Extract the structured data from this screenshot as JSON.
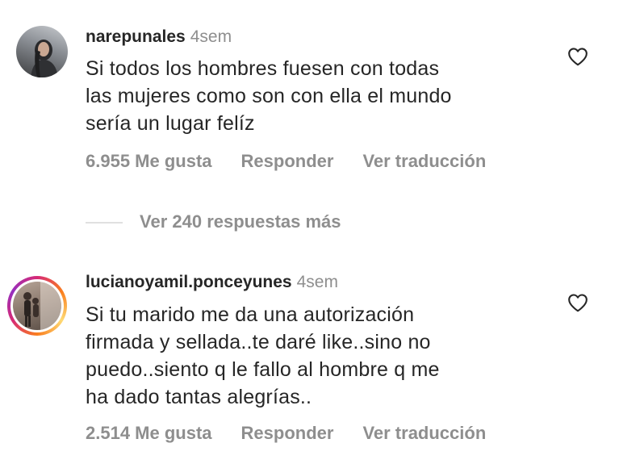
{
  "comments": [
    {
      "username": "narepunales",
      "time": "4sem",
      "text_lines": [
        "Si todos los hombres fuesen con todas",
        "las mujeres como son con ella el mundo",
        "sería un lugar felíz"
      ],
      "likes": "6.955 Me gusta",
      "reply_label": "Responder",
      "translate_label": "Ver traducción",
      "avatar_icon": "user-avatar",
      "like_icon": "heart-outline-icon"
    },
    {
      "username": "lucianoyamil.ponceyunes",
      "time": "4sem",
      "text_lines": [
        "Si tu marido me da una autorización",
        "firmada y sellada..te daré like..sino no",
        "puedo..siento q le fallo al hombre q me",
        "ha dado tantas alegrías.."
      ],
      "likes": "2.514 Me gusta",
      "reply_label": "Responder",
      "translate_label": "Ver traducción",
      "avatar_icon": "user-avatar-story-ring",
      "like_icon": "heart-outline-icon"
    }
  ],
  "view_replies_label": "Ver 240 respuestas más",
  "colors": {
    "text_primary": "#262626",
    "text_secondary": "#8e8e8e",
    "background": "#ffffff",
    "divider": "#e0e0e0"
  }
}
